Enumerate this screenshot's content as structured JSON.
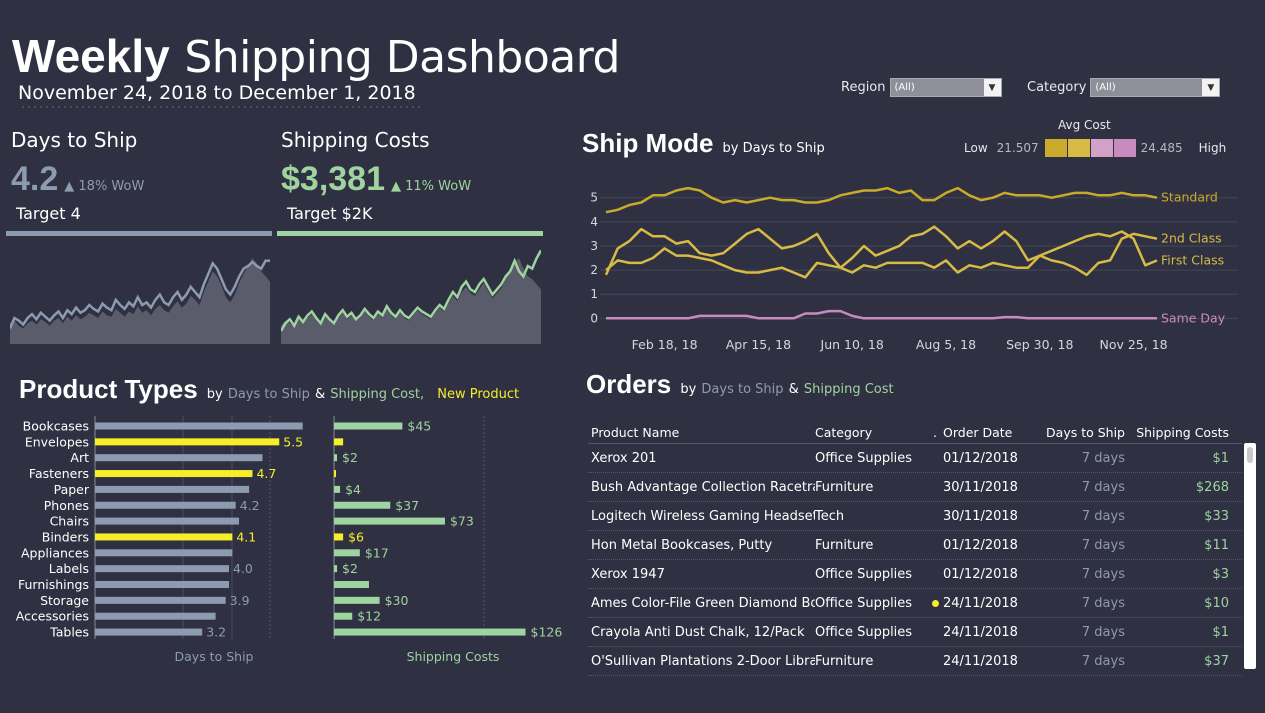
{
  "header": {
    "title_bold": "Weekly",
    "title_rest": "Shipping Dashboard",
    "date_range": "November 24, 2018 to December 1, 2018"
  },
  "filters": {
    "region": {
      "label": "Region",
      "value": "(All)"
    },
    "category": {
      "label": "Category",
      "value": "(All)"
    }
  },
  "kpis": {
    "days": {
      "label": "Days to Ship",
      "value": "4.2",
      "wow": "▲ 18% WoW",
      "target": "Target 4",
      "color": "#8d9bb1"
    },
    "costs": {
      "label": "Shipping Costs",
      "value": "$3,381",
      "wow": "▲ 11% WoW",
      "target": "Target $2K",
      "color": "#9fd39f"
    }
  },
  "ship_mode": {
    "title": "Ship Mode",
    "subtitle": "by Days to Ship",
    "legend": {
      "title": "Avg Cost",
      "low_label": "Low",
      "low": "21.507",
      "high": "24.485",
      "high_label": "High",
      "colors": [
        "#c9aa2a",
        "#d7bb45",
        "#d3a0c9",
        "#c98bbd"
      ]
    }
  },
  "product_types": {
    "title": "Product Types",
    "by": "by",
    "days_label": "Days to Ship",
    "amp": "&",
    "cost_label": "Shipping Cost,",
    "new_label": "New Product",
    "axis_days": "Days to Ship",
    "axis_cost": "Shipping Costs"
  },
  "orders": {
    "title": "Orders",
    "by": "by",
    "days_label": "Days to Ship",
    "amp": "&",
    "cost_label": "Shipping Cost",
    "columns": [
      "Product Name",
      "Category",
      ".",
      "Order Date",
      "Days to Ship",
      "Shipping Costs"
    ],
    "rows": [
      {
        "name": "Xerox 201",
        "category": "Office Supplies",
        "new": false,
        "date": "01/12/2018",
        "days": "7 days",
        "cost": "$1"
      },
      {
        "name": "Bush Advantage Collection Racetra..",
        "category": "Furniture",
        "new": false,
        "date": "30/11/2018",
        "days": "7 days",
        "cost": "$268"
      },
      {
        "name": "Logitech Wireless Gaming Headset..",
        "category": "Tech",
        "new": false,
        "date": "30/11/2018",
        "days": "7 days",
        "cost": "$33"
      },
      {
        "name": "Hon Metal Bookcases, Putty",
        "category": "Furniture",
        "new": false,
        "date": "01/12/2018",
        "days": "7 days",
        "cost": "$11"
      },
      {
        "name": "Xerox 1947",
        "category": "Office Supplies",
        "new": false,
        "date": "01/12/2018",
        "days": "7 days",
        "cost": "$3"
      },
      {
        "name": "Ames Color-File Green Diamond Bo..",
        "category": "Office Supplies",
        "new": true,
        "date": "24/11/2018",
        "days": "7 days",
        "cost": "$10"
      },
      {
        "name": "Crayola Anti Dust Chalk, 12/Pack",
        "category": "Office Supplies",
        "new": false,
        "date": "24/11/2018",
        "days": "7 days",
        "cost": "$1"
      },
      {
        "name": "O'Sullivan Plantations 2-Door Libra..",
        "category": "Furniture",
        "new": false,
        "date": "24/11/2018",
        "days": "7 days",
        "cost": "$37"
      }
    ]
  },
  "chart_data": [
    {
      "type": "area",
      "name": "days-to-ship-sparkline",
      "x_count": 60,
      "line": [
        1.2,
        2.0,
        1.8,
        1.5,
        2.0,
        2.3,
        1.9,
        2.4,
        2.1,
        1.8,
        2.2,
        2.5,
        2.0,
        2.6,
        2.3,
        2.8,
        2.4,
        2.6,
        3.0,
        2.7,
        2.5,
        3.1,
        2.8,
        2.6,
        3.4,
        3.0,
        2.7,
        3.2,
        2.9,
        3.6,
        3.0,
        3.2,
        2.8,
        3.4,
        3.8,
        3.2,
        3.0,
        3.6,
        4.0,
        3.4,
        3.8,
        4.4,
        4.0,
        3.6,
        4.6,
        5.4,
        6.2,
        5.8,
        5.0,
        4.2,
        3.8,
        4.4,
        5.2,
        5.8,
        6.0,
        6.3,
        6.0,
        5.8,
        6.4,
        6.4
      ],
      "area": [
        1.6,
        1.8,
        1.4,
        1.2,
        1.6,
        1.8,
        1.5,
        1.9,
        1.7,
        1.4,
        1.8,
        2.0,
        1.6,
        2.1,
        1.8,
        2.2,
        1.9,
        2.1,
        2.4,
        2.2,
        2.0,
        2.5,
        2.2,
        2.1,
        2.7,
        2.4,
        2.1,
        2.5,
        2.3,
        2.9,
        2.4,
        2.6,
        2.2,
        2.7,
        3.0,
        2.6,
        2.4,
        2.9,
        3.3,
        2.8,
        3.1,
        3.7,
        3.4,
        3.0,
        4.0,
        4.8,
        5.6,
        5.2,
        4.5,
        3.6,
        3.2,
        3.8,
        4.7,
        5.4,
        6.0,
        6.6,
        6.2,
        5.6,
        5.2,
        4.8
      ],
      "ymax": 8
    },
    {
      "type": "area",
      "name": "shipping-costs-sparkline",
      "x_count": 60,
      "line": [
        1.0,
        1.6,
        1.9,
        1.4,
        2.1,
        1.7,
        2.2,
        2.5,
        2.0,
        1.6,
        2.3,
        1.9,
        1.6,
        2.2,
        2.6,
        2.1,
        2.4,
        1.9,
        2.2,
        2.7,
        2.3,
        2.0,
        2.5,
        2.2,
        2.9,
        2.4,
        2.1,
        2.6,
        2.2,
        2.0,
        2.4,
        2.8,
        2.5,
        2.3,
        2.1,
        2.6,
        3.0,
        2.7,
        3.4,
        4.0,
        3.6,
        4.4,
        4.8,
        4.2,
        4.0,
        4.6,
        5.0,
        4.4,
        3.8,
        4.2,
        4.6,
        5.2,
        5.6,
        6.4,
        5.6,
        5.2,
        6.0,
        5.8,
        6.6,
        7.2
      ],
      "area": [
        1.4,
        1.8,
        1.6,
        1.3,
        1.9,
        1.6,
        2.0,
        2.3,
        1.9,
        1.5,
        2.1,
        1.8,
        1.5,
        2.0,
        2.4,
        1.9,
        2.2,
        1.8,
        2.0,
        2.5,
        2.1,
        1.8,
        2.3,
        2.0,
        2.7,
        2.2,
        1.9,
        2.4,
        2.0,
        1.8,
        2.2,
        2.6,
        2.3,
        2.1,
        1.9,
        2.4,
        2.8,
        2.5,
        3.1,
        3.7,
        3.3,
        4.0,
        4.4,
        3.9,
        3.7,
        4.2,
        4.7,
        4.1,
        3.5,
        3.9,
        4.3,
        5.0,
        5.6,
        6.3,
        6.6,
        5.8,
        5.2,
        5.0,
        4.6,
        4.2
      ],
      "ymax": 8
    },
    {
      "type": "line",
      "name": "ship-mode",
      "x_labels": [
        "Feb 18, 18",
        "Apr 15, 18",
        "Jun 10, 18",
        "Aug 5, 18",
        "Sep 30, 18",
        "Nov 25, 18"
      ],
      "x_label_index": [
        5,
        13,
        21,
        29,
        37,
        45
      ],
      "yticks": [
        0,
        1,
        2,
        3,
        4,
        5
      ],
      "ylim": [
        -0.4,
        5.9
      ],
      "series": [
        {
          "name": "Standard",
          "color": "#c9aa2a",
          "values": [
            4.4,
            4.5,
            4.7,
            4.8,
            5.1,
            5.1,
            5.3,
            5.4,
            5.3,
            5.0,
            4.8,
            4.9,
            4.8,
            4.9,
            5.0,
            4.9,
            4.9,
            4.8,
            4.8,
            4.9,
            5.1,
            5.2,
            5.3,
            5.3,
            5.4,
            5.2,
            5.3,
            4.9,
            4.9,
            5.2,
            5.4,
            5.1,
            4.9,
            5.0,
            5.2,
            5.1,
            5.1,
            5.1,
            5.0,
            5.1,
            5.2,
            5.2,
            5.1,
            5.1,
            5.2,
            5.1,
            5.1,
            5.0
          ]
        },
        {
          "name": "2nd Class",
          "color": "#d7bb45",
          "values": [
            1.8,
            2.9,
            3.2,
            3.7,
            3.4,
            3.4,
            3.1,
            3.2,
            2.7,
            2.6,
            2.7,
            3.1,
            3.5,
            3.7,
            3.3,
            2.9,
            3.0,
            3.2,
            3.5,
            2.7,
            2.1,
            2.5,
            3.0,
            2.6,
            2.8,
            3.0,
            3.4,
            3.5,
            3.8,
            3.4,
            2.9,
            3.2,
            2.9,
            3.2,
            3.6,
            3.2,
            2.4,
            2.6,
            2.4,
            2.3,
            2.1,
            1.8,
            2.3,
            2.4,
            3.3,
            3.5,
            3.4,
            3.3
          ]
        },
        {
          "name": "First Class",
          "color": "#d7bb45",
          "values": [
            2.0,
            2.4,
            2.3,
            2.3,
            2.5,
            2.9,
            2.6,
            2.6,
            2.5,
            2.4,
            2.2,
            2.0,
            1.9,
            1.9,
            2.0,
            2.1,
            1.9,
            1.7,
            2.3,
            2.2,
            2.1,
            1.9,
            2.2,
            2.1,
            2.3,
            2.3,
            2.3,
            2.3,
            2.1,
            2.4,
            1.9,
            2.2,
            2.1,
            2.3,
            2.2,
            2.1,
            2.1,
            2.6,
            2.8,
            3.0,
            3.2,
            3.4,
            3.5,
            3.4,
            3.6,
            3.3,
            2.2,
            2.4
          ]
        },
        {
          "name": "Same Day",
          "color": "#c98bbd",
          "values": [
            0,
            0,
            0,
            0,
            0,
            0,
            0,
            0,
            0.1,
            0.1,
            0.1,
            0.1,
            0.1,
            0,
            0,
            0,
            0,
            0.2,
            0.2,
            0.3,
            0.3,
            0.1,
            0,
            0,
            0,
            0,
            0,
            0,
            0,
            0,
            0,
            0,
            0,
            0,
            0.05,
            0.05,
            0,
            0,
            0,
            0,
            0,
            0,
            0,
            0,
            0,
            0,
            0,
            0
          ]
        }
      ]
    },
    {
      "type": "bar",
      "name": "product-types-days",
      "categories": [
        "Bookcases",
        "Envelopes",
        "Art",
        "Fasteners",
        "Paper",
        "Phones",
        "Chairs",
        "Binders",
        "Appliances",
        "Labels",
        "Furnishings",
        "Storage",
        "Accessories",
        "Tables"
      ],
      "values": [
        6.2,
        5.5,
        5.0,
        4.7,
        4.6,
        4.2,
        4.3,
        4.1,
        4.1,
        4.0,
        4.0,
        3.9,
        3.6,
        3.2
      ],
      "labels": [
        "",
        "5.5",
        "",
        "4.7",
        "",
        "4.2",
        "",
        "4.1",
        "",
        "4.0",
        "",
        "3.9",
        "",
        "3.2"
      ],
      "new_product": [
        false,
        true,
        false,
        true,
        false,
        false,
        false,
        true,
        false,
        false,
        false,
        false,
        false,
        false
      ],
      "xlim": [
        0,
        8
      ]
    },
    {
      "type": "bar",
      "name": "product-types-cost",
      "categories": [
        "Bookcases",
        "Envelopes",
        "Art",
        "Fasteners",
        "Paper",
        "Phones",
        "Chairs",
        "Binders",
        "Appliances",
        "Labels",
        "Furnishings",
        "Storage",
        "Accessories",
        "Tables"
      ],
      "values": [
        45,
        6,
        2,
        1,
        4,
        37,
        73,
        6,
        17,
        2,
        23,
        30,
        12,
        126
      ],
      "labels": [
        "$45",
        "",
        "$2",
        "",
        "$4",
        "$37",
        "$73",
        "$6",
        "$17",
        "$2",
        "",
        "$30",
        "$12",
        "$126"
      ],
      "new_product": [
        false,
        true,
        false,
        true,
        false,
        false,
        false,
        true,
        false,
        false,
        false,
        false,
        false,
        false
      ],
      "xlim": [
        0,
        130
      ]
    }
  ],
  "colors": {
    "background": "#2f3142",
    "days_blue": "#8d9bb1",
    "cost_green": "#9fd39f",
    "new_yellow": "#f6ee2b",
    "gold": "#c9aa2a",
    "pink": "#c98bbd"
  }
}
